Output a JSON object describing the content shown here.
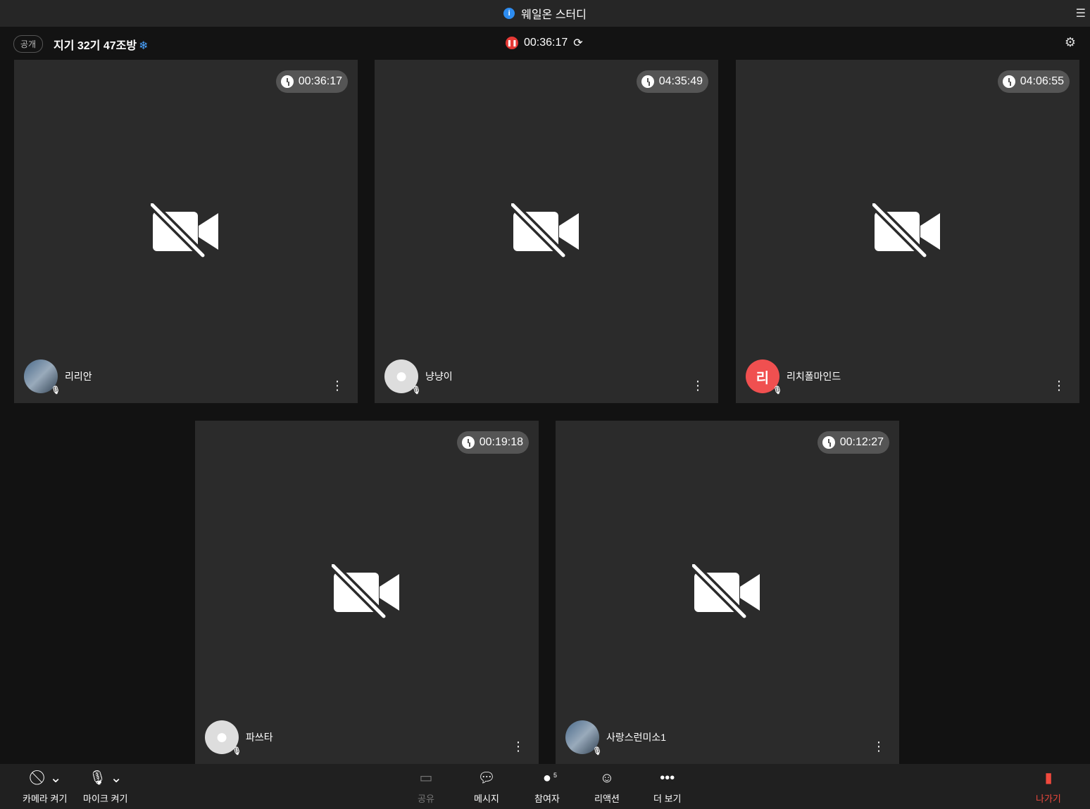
{
  "title": "웨일온 스터디",
  "header": {
    "visibility": "공개",
    "room_name": "지기 32기 47조방",
    "room_icon": "❄",
    "elapsed": "00:36:17"
  },
  "participants": [
    {
      "name": "리리안",
      "time": "00:36:17",
      "avatar": "photo"
    },
    {
      "name": "냥냥이",
      "time": "04:35:49",
      "avatar": "default"
    },
    {
      "name": "리치폴마인드",
      "time": "04:06:55",
      "avatar": "리"
    },
    {
      "name": "파쓰타",
      "time": "00:19:18",
      "avatar": "default"
    },
    {
      "name": "사랑스런미소1",
      "time": "00:12:27",
      "avatar": "photo"
    }
  ],
  "toolbar": {
    "camera": "카메라 켜기",
    "mic": "마이크 켜기",
    "share": "공유",
    "message": "메시지",
    "participants": "참여자",
    "participant_count": "5",
    "reaction": "리액션",
    "more": "더 보기",
    "leave": "나가기"
  }
}
